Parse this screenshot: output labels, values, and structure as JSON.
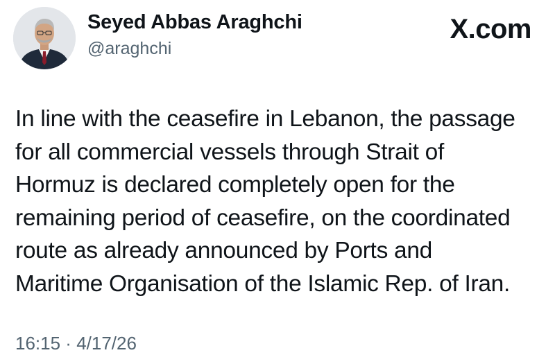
{
  "author": {
    "display_name": "Seyed Abbas Araghchi",
    "handle": "@araghchi"
  },
  "brand": {
    "label": "X.com"
  },
  "tweet": {
    "lines": [
      "In line with the ceasefire in Lebanon, the passage",
      "for all commercial vessels through Strait of",
      "Hormuz is declared completely open for the",
      "remaining period of ceasefire, on the coordinated",
      "route as already announced by Ports and",
      "Maritime Organisation of the Islamic Rep. of Iran."
    ]
  },
  "meta": {
    "time": "16:15",
    "separator": " · ",
    "date": "4/17/26"
  }
}
